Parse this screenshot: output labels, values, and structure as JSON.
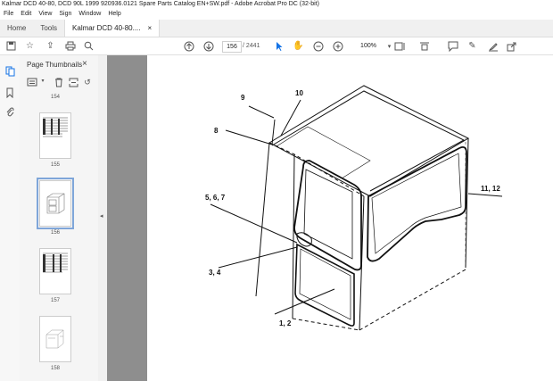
{
  "window": {
    "title": "Kalmar DCD 40-80, DCD 90L 1999 920936.0121 Spare Parts Catalog EN+SW.pdf - Adobe Acrobat Pro DC (32-bit)"
  },
  "menu": [
    "File",
    "Edit",
    "View",
    "Sign",
    "Window",
    "Help"
  ],
  "tabs": {
    "home": "Home",
    "tools": "Tools",
    "doc": "Kalmar DCD 40-80....",
    "close": "×"
  },
  "toolbar": {
    "page_current": "156",
    "page_total": "/ 2441",
    "zoom": "100%"
  },
  "thumbnails_panel": {
    "title": "Page Thumbnails",
    "close": "×",
    "pages": [
      "154",
      "155",
      "156",
      "157",
      "158"
    ],
    "selected": "156"
  },
  "drawing": {
    "labels": [
      "9",
      "10",
      "8",
      "5, 6, 7",
      "11, 12",
      "3, 4",
      "1, 2"
    ]
  },
  "colors": {
    "selection": "#7fa6d9",
    "doc_background": "#8e8e8e",
    "cursor_blue": "#1473e6"
  },
  "icons": [
    "save-icon",
    "star-icon",
    "upload-icon",
    "print-icon",
    "search-icon",
    "arrow-up-icon",
    "arrow-down-icon",
    "pointer-icon",
    "hand-icon",
    "zoom-out-icon",
    "zoom-in-icon",
    "fit-page-icon",
    "comment-icon",
    "pen-icon",
    "highlight-icon",
    "share-icon"
  ]
}
